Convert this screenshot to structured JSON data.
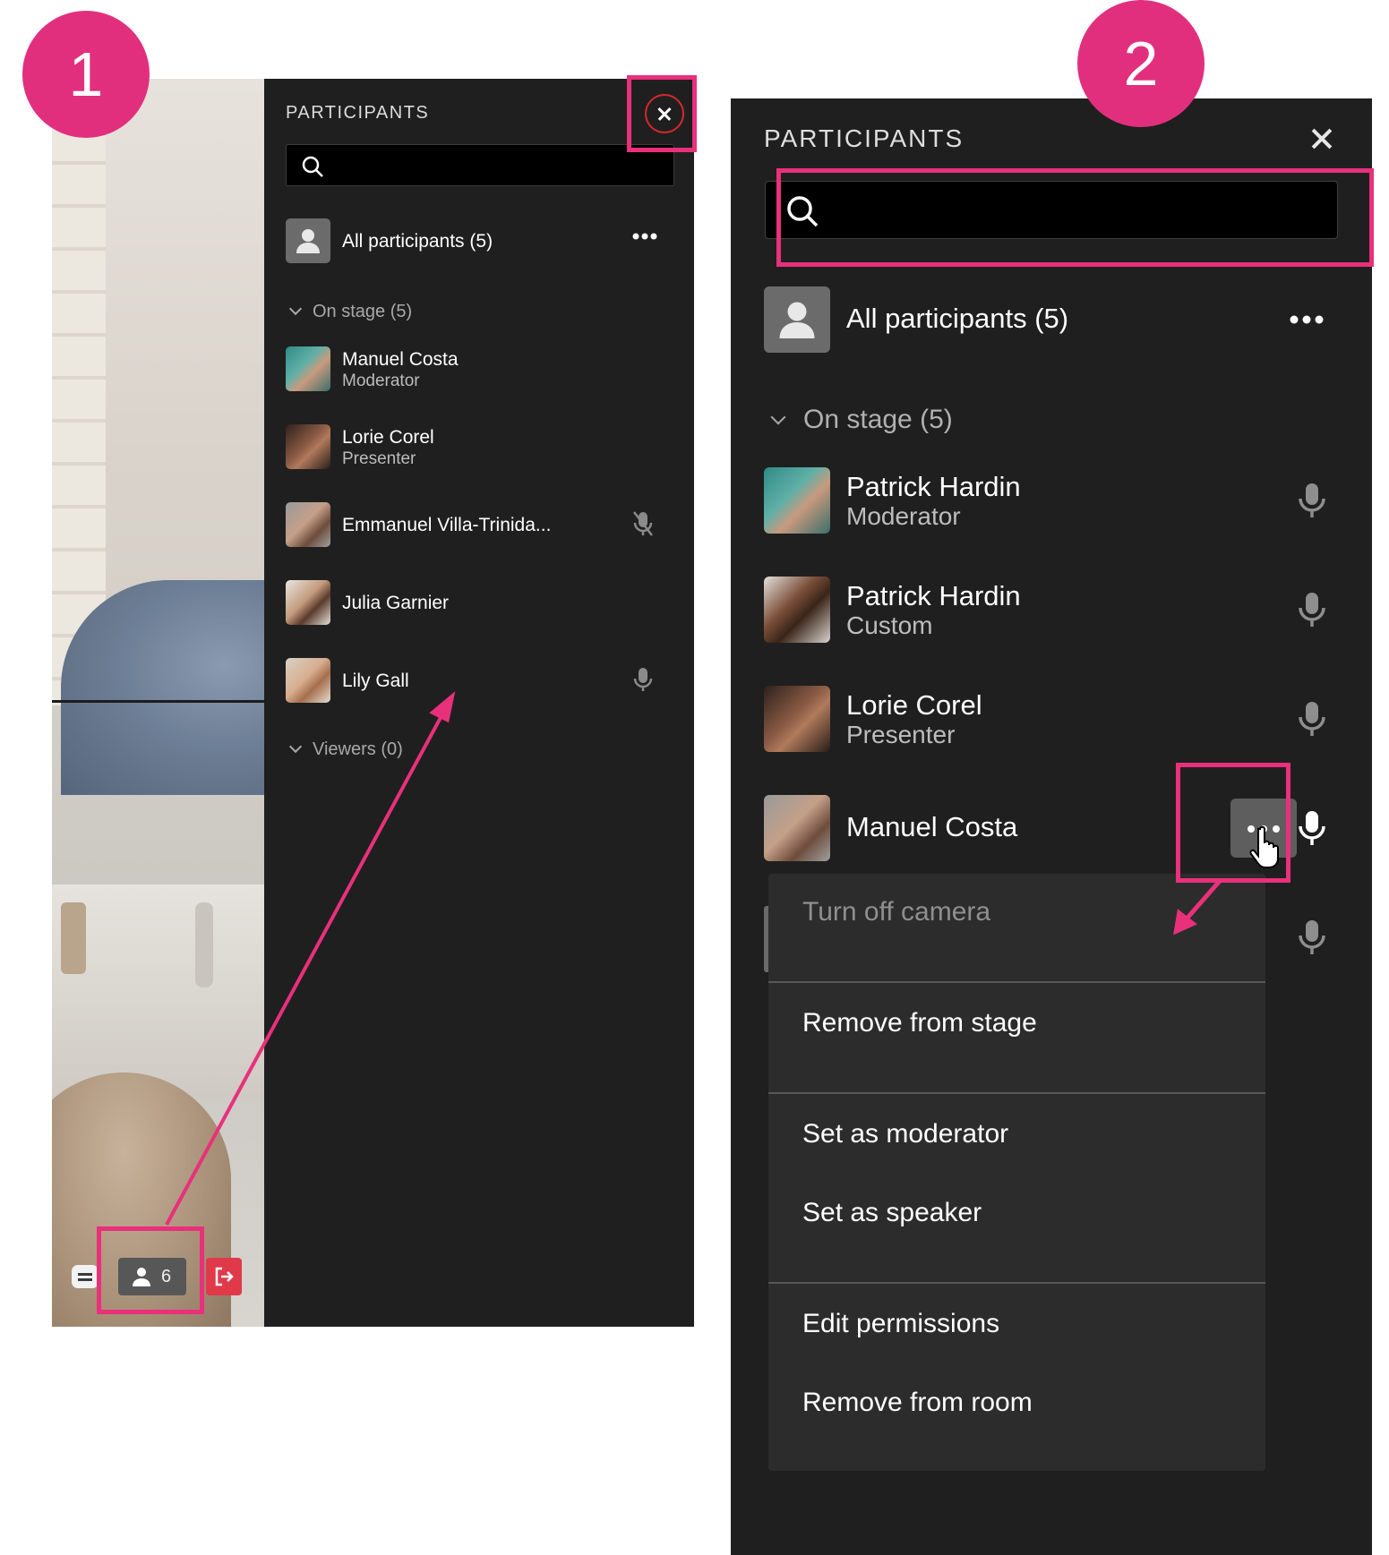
{
  "steps": {
    "step1": "1",
    "step2": "2"
  },
  "panel1": {
    "title": "PARTICIPANTS",
    "search_placeholder": "",
    "all_participants": "All participants (5)",
    "on_stage": "On stage (5)",
    "viewers": "Viewers (0)",
    "participants": [
      {
        "name": "Manuel Costa",
        "role": "Moderator",
        "mic": "none"
      },
      {
        "name": "Lorie Corel",
        "role": "Presenter",
        "mic": "none"
      },
      {
        "name": "Emmanuel Villa-Trinida...",
        "role": "",
        "mic": "muted"
      },
      {
        "name": "Julia Garnier",
        "role": "",
        "mic": "none"
      },
      {
        "name": "Lily Gall",
        "role": "",
        "mic": "on"
      }
    ],
    "toolbar": {
      "participant_count": "6"
    }
  },
  "panel2": {
    "title": "PARTICIPANTS",
    "search_placeholder": "",
    "all_participants": "All participants (5)",
    "on_stage": "On stage (5)",
    "participants": [
      {
        "name": "Patrick Hardin",
        "role": "Moderator"
      },
      {
        "name": "Patrick Hardin",
        "role": "Custom"
      },
      {
        "name": "Lorie Corel",
        "role": "Presenter"
      },
      {
        "name": "Manuel Costa",
        "role": ""
      }
    ],
    "menu": {
      "turn_off_camera": "Turn off camera",
      "remove_from_stage": "Remove from stage",
      "set_as_moderator": "Set as moderator",
      "set_as_speaker": "Set as speaker",
      "edit_permissions": "Edit permissions",
      "remove_from_room": "Remove from room"
    }
  },
  "colors": {
    "panel_bg": "#1f1f1f",
    "menu_bg": "#2c2c2c",
    "highlight": "#e9307b",
    "badge": "#e22f7d",
    "close_ring": "#d6282c",
    "leave_button": "#e03a4a"
  },
  "icons": [
    "search-icon",
    "close-icon",
    "more-icon",
    "mic-icon",
    "mic-muted-icon",
    "chevron-down-icon",
    "person-icon",
    "chat-icon",
    "leave-icon",
    "hand-cursor-icon"
  ]
}
